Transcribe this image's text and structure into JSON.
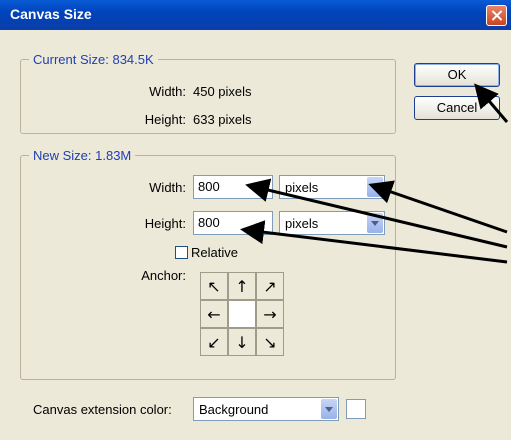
{
  "window": {
    "title": "Canvas Size"
  },
  "current": {
    "legend": "Current Size: 834.5K",
    "width_label": "Width:",
    "width_value": "450 pixels",
    "height_label": "Height:",
    "height_value": "633 pixels"
  },
  "new": {
    "legend": "New Size: 1.83M",
    "width_label": "Width:",
    "width_value": "800",
    "width_unit": "pixels",
    "height_label": "Height:",
    "height_value": "800",
    "height_unit": "pixels",
    "relative_label": "Relative",
    "anchor_label": "Anchor:",
    "anchor_icons": [
      "arrow-up-left",
      "arrow-up",
      "arrow-up-right",
      "arrow-left",
      "",
      "arrow-right",
      "arrow-down-left",
      "arrow-down",
      "arrow-down-right"
    ]
  },
  "extension": {
    "label": "Canvas extension color:",
    "value": "Background"
  },
  "buttons": {
    "ok": "OK",
    "cancel": "Cancel"
  },
  "colors": {
    "title_bar": "#0a5bd6",
    "legend_text": "#1f3fb4",
    "dialog_bg": "#ece9d8"
  }
}
